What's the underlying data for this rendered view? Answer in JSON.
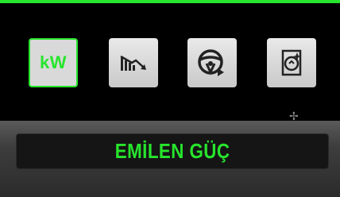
{
  "colors": {
    "accent": "#27e52c",
    "button_bg": "#d9d9d9",
    "panel_bg": "#151515"
  },
  "icons": [
    {
      "name": "kw-icon",
      "label": "kW",
      "selected": true
    },
    {
      "name": "energy-decrease-chart-icon",
      "selected": false
    },
    {
      "name": "steering-wheel-icon",
      "selected": false
    },
    {
      "name": "meter-sparkle-icon",
      "selected": false
    }
  ],
  "title": "EMİLEN GÜÇ"
}
